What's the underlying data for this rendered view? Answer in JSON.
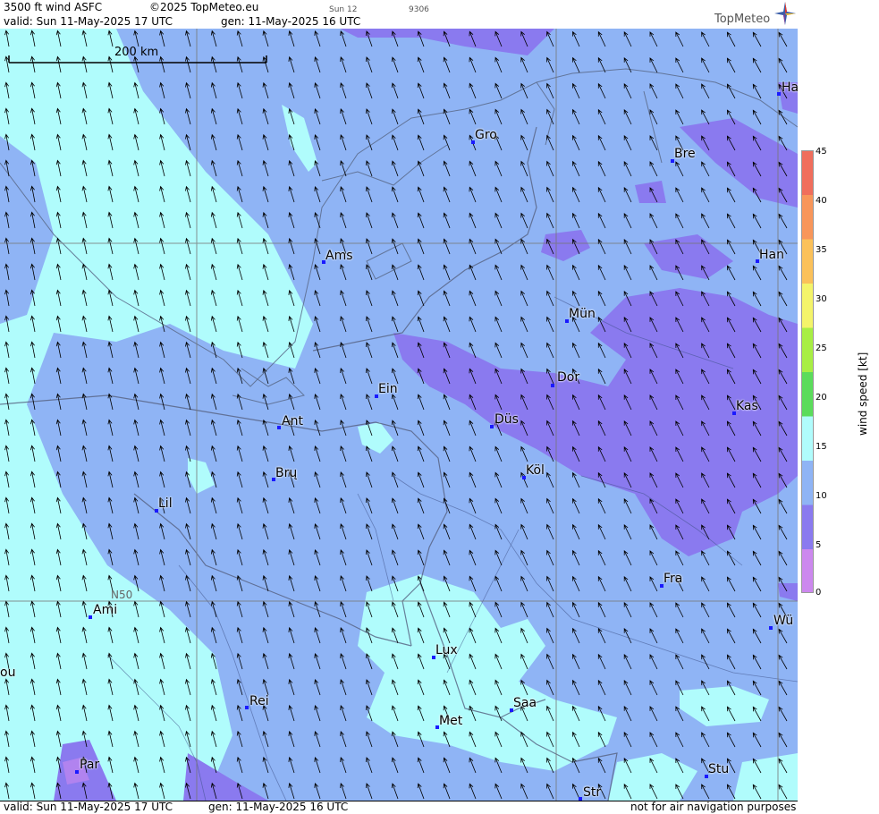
{
  "header": {
    "title": "3500 ft wind ASFC",
    "copyright": "©2025 TopMeteo.eu",
    "day_code": "Sun 12",
    "code": "9306",
    "valid": "valid:  Sun  11-May-2025  17 UTC",
    "gen": "gen: 11-May-2025 16 UTC",
    "brand": "TopMeteo"
  },
  "scale_bar": {
    "label": "200 km"
  },
  "grid_label": "N50",
  "cities": [
    {
      "name": "Ha"
    },
    {
      "name": "Gro"
    },
    {
      "name": "Bre"
    },
    {
      "name": "Ams"
    },
    {
      "name": "Han"
    },
    {
      "name": "Mün"
    },
    {
      "name": "Ein"
    },
    {
      "name": "Dor"
    },
    {
      "name": "Kas"
    },
    {
      "name": "Ant"
    },
    {
      "name": "Düs"
    },
    {
      "name": "Brų"
    },
    {
      "name": "Köl"
    },
    {
      "name": "Lil"
    },
    {
      "name": "Fra"
    },
    {
      "name": "Ami"
    },
    {
      "name": "Wü"
    },
    {
      "name": "Lux"
    },
    {
      "name": "ou"
    },
    {
      "name": "Rei"
    },
    {
      "name": "Saa"
    },
    {
      "name": "Met"
    },
    {
      "name": "Par"
    },
    {
      "name": "Stu"
    },
    {
      "name": "Str"
    }
  ],
  "legend": {
    "title": "wind  speed  [kt]",
    "ticks": [
      "45",
      "40",
      "35",
      "30",
      "25",
      "20",
      "15",
      "10",
      "5",
      "0"
    ],
    "colors": [
      "#cc88ee",
      "#8a7aef",
      "#8fb4f5",
      "#b0fcfc",
      "#5bdc5b",
      "#a8ee44",
      "#f4f46a",
      "#fbc15a",
      "#f8965a",
      "#f06e5c"
    ]
  },
  "footer": {
    "valid": "valid:  Sun  11-May-2025  17 UTC",
    "gen": "gen: 11-May-2025 16 UTC",
    "note": "not for air navigation purposes"
  },
  "wind_field": {
    "direction": "from SE toward NW",
    "base_speed_kt": "10-15"
  }
}
